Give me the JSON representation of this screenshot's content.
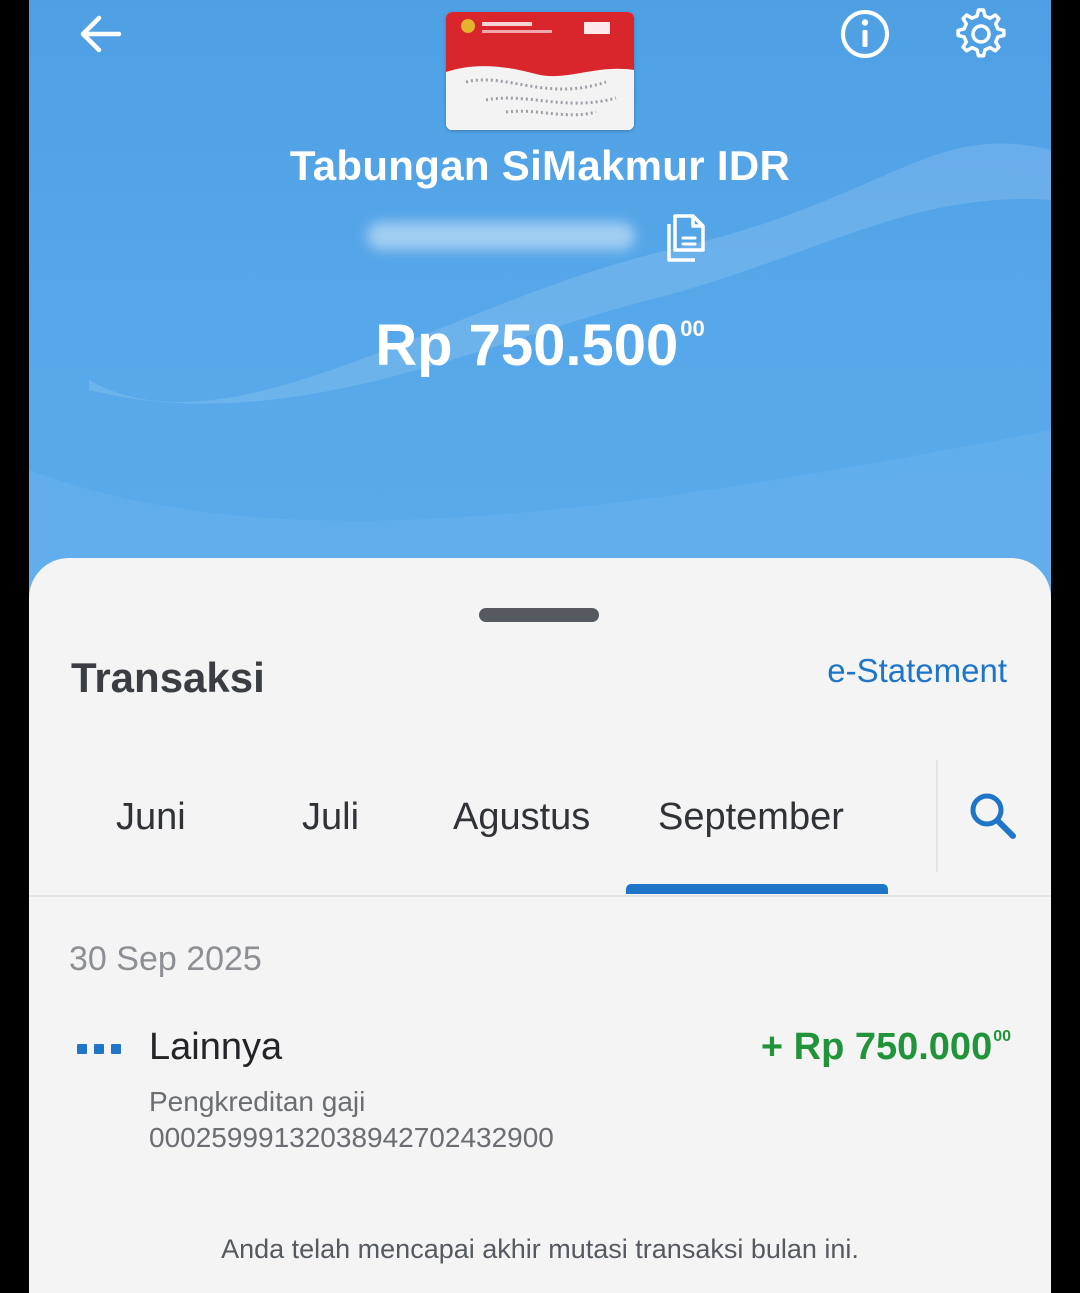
{
  "header": {
    "account_name": "Tabungan SiMakmur IDR",
    "balance_main": "Rp 750.500",
    "balance_cents": "00"
  },
  "sheet": {
    "section_title": "Transaksi",
    "estatement_label": "e-Statement",
    "tabs": [
      {
        "label": "Juni",
        "selected": false
      },
      {
        "label": "Juli",
        "selected": false
      },
      {
        "label": "Agustus",
        "selected": false
      },
      {
        "label": "September",
        "selected": true
      }
    ]
  },
  "transactions": [
    {
      "date": "30 Sep 2025",
      "category": "Lainnya",
      "description": "Pengkreditan gaji",
      "reference": "00025999132038942702432900",
      "amount_main": "+ Rp 750.000",
      "amount_cents": "00"
    }
  ],
  "footer_note": "Anda telah mencapai akhir mutasi transaksi bulan ini.",
  "colors": {
    "header_blue": "#57a8ea",
    "accent_blue": "#1f75c7",
    "credit_green": "#21943b"
  },
  "icons": [
    "back-arrow-icon",
    "info-icon",
    "gear-icon",
    "copy-icon",
    "search-icon",
    "more-dots-icon"
  ]
}
